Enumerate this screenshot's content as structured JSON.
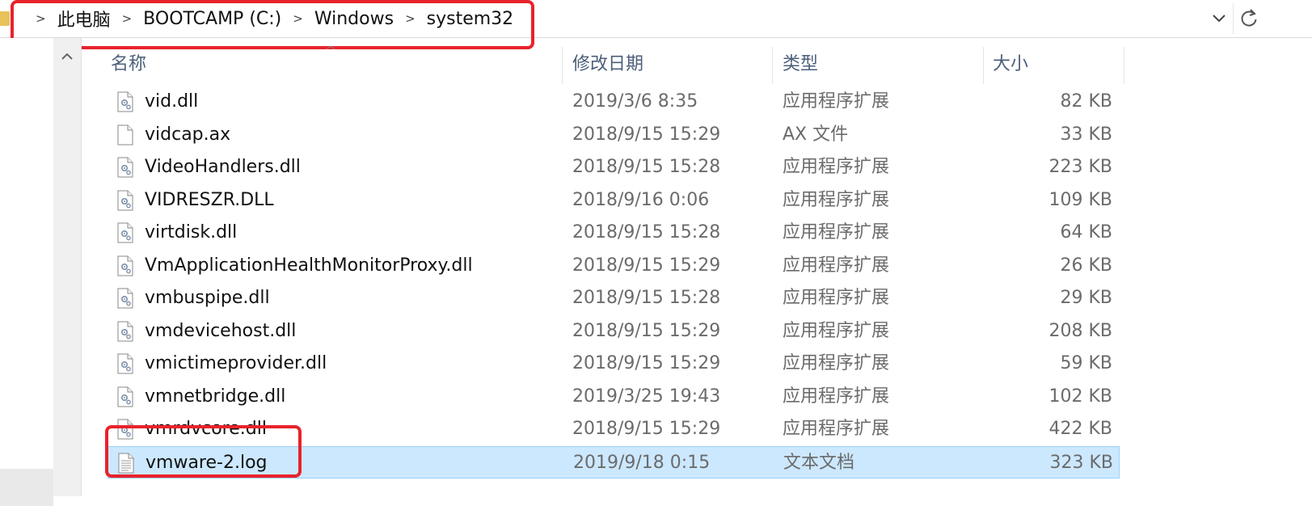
{
  "addressbar": {
    "crumbs": [
      "此电脑",
      "BOOTCAMP (C:)",
      "Windows",
      "system32"
    ],
    "dropdown_icon": "chevron-down-icon",
    "refresh_icon": "refresh-icon"
  },
  "columns": {
    "name": "名称",
    "date": "修改日期",
    "type": "类型",
    "size": "大小"
  },
  "files": [
    {
      "name": "vid.dll",
      "date": "2019/3/6 8:35",
      "type": "应用程序扩展",
      "size": "82 KB",
      "icon": "dll-file-icon"
    },
    {
      "name": "vidcap.ax",
      "date": "2018/9/15 15:29",
      "type": "AX 文件",
      "size": "33 KB",
      "icon": "blank-file-icon"
    },
    {
      "name": "VideoHandlers.dll",
      "date": "2018/9/15 15:28",
      "type": "应用程序扩展",
      "size": "223 KB",
      "icon": "dll-file-icon"
    },
    {
      "name": "VIDRESZR.DLL",
      "date": "2018/9/16 0:06",
      "type": "应用程序扩展",
      "size": "109 KB",
      "icon": "dll-file-icon"
    },
    {
      "name": "virtdisk.dll",
      "date": "2018/9/15 15:28",
      "type": "应用程序扩展",
      "size": "64 KB",
      "icon": "dll-file-icon"
    },
    {
      "name": "VmApplicationHealthMonitorProxy.dll",
      "date": "2018/9/15 15:29",
      "type": "应用程序扩展",
      "size": "26 KB",
      "icon": "dll-file-icon"
    },
    {
      "name": "vmbuspipe.dll",
      "date": "2018/9/15 15:28",
      "type": "应用程序扩展",
      "size": "29 KB",
      "icon": "dll-file-icon"
    },
    {
      "name": "vmdevicehost.dll",
      "date": "2018/9/15 15:29",
      "type": "应用程序扩展",
      "size": "208 KB",
      "icon": "dll-file-icon"
    },
    {
      "name": "vmictimeprovider.dll",
      "date": "2018/9/15 15:29",
      "type": "应用程序扩展",
      "size": "59 KB",
      "icon": "dll-file-icon"
    },
    {
      "name": "vmnetbridge.dll",
      "date": "2019/3/25 19:43",
      "type": "应用程序扩展",
      "size": "102 KB",
      "icon": "dll-file-icon"
    },
    {
      "name": "vmrdvcore.dll",
      "date": "2018/9/15 15:29",
      "type": "应用程序扩展",
      "size": "422 KB",
      "icon": "dll-file-icon"
    },
    {
      "name": "vmware-2.log",
      "date": "2019/9/18 0:15",
      "type": "文本文档",
      "size": "323 KB",
      "icon": "text-file-icon",
      "selected": true
    }
  ],
  "colors": {
    "selection": "#cce8ff",
    "annotation": "#e8232b",
    "header_text": "#4c607a"
  }
}
